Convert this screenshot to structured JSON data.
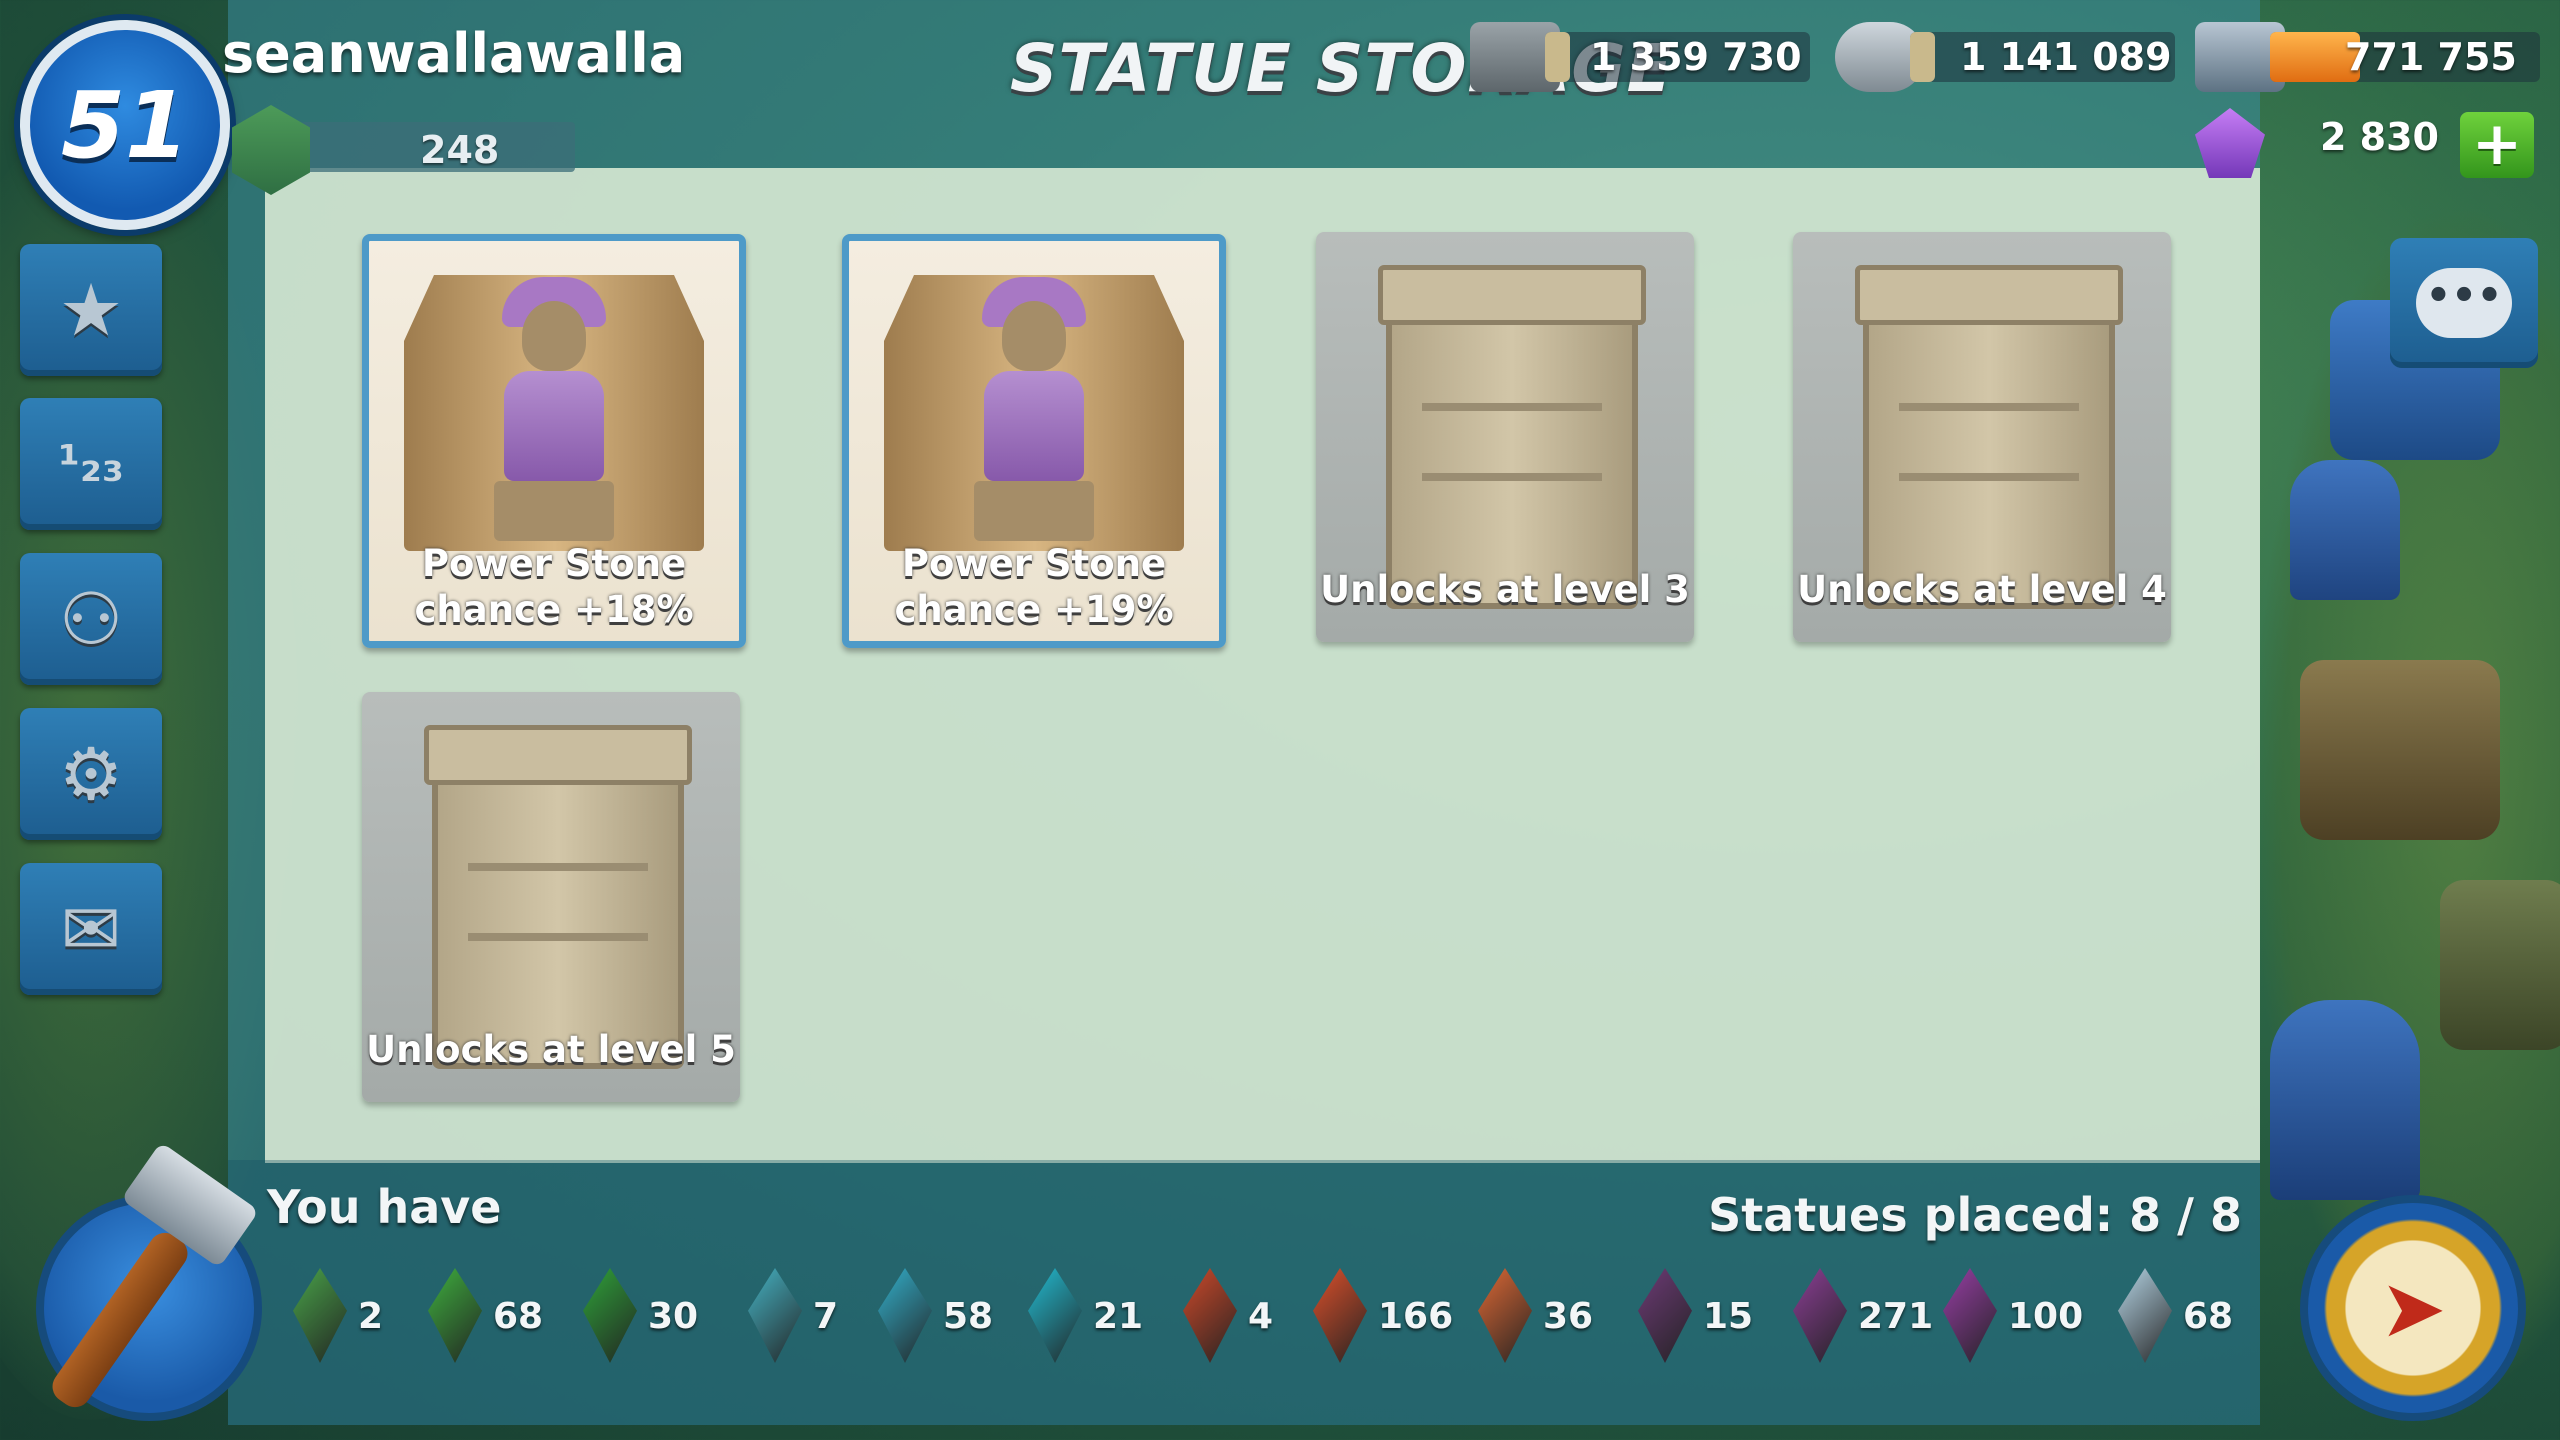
{
  "player": {
    "level": "51",
    "name": "seanwallawalla",
    "xp": "248"
  },
  "title": "STATUE STORAGE",
  "resources": {
    "wood": "1 359 730",
    "stone": "1 141 089",
    "iron": "771 755",
    "diamonds": "2 830",
    "add_diamonds": "+"
  },
  "side_menu": [
    {
      "name": "leaderboard-button",
      "icon": "stars-icon",
      "glyph": "★"
    },
    {
      "name": "rankings-button",
      "icon": "podium-icon",
      "glyph": "1 2 3"
    },
    {
      "name": "task-force-button",
      "icon": "group-icon",
      "glyph": "⚇"
    },
    {
      "name": "settings-button",
      "icon": "gears-icon",
      "glyph": "⚙"
    },
    {
      "name": "mail-button",
      "icon": "envelope-icon",
      "glyph": "✉"
    }
  ],
  "slots": [
    {
      "state": "filled",
      "caption_line1": "Power Stone",
      "caption_line2": "chance +18%"
    },
    {
      "state": "filled",
      "caption_line1": "Power Stone",
      "caption_line2": "chance +19%"
    },
    {
      "state": "locked",
      "caption": "Unlocks at level 3"
    },
    {
      "state": "locked",
      "caption": "Unlocks at level 4"
    },
    {
      "state": "locked",
      "caption": "Unlocks at level 5"
    }
  ],
  "inventory": {
    "label": "You have",
    "statues_placed": "Statues placed: 8 / 8",
    "items": [
      {
        "name": "life-fragment",
        "count": "2",
        "color": "#4aa64a"
      },
      {
        "name": "life-shard",
        "count": "68",
        "color": "#3fb33f"
      },
      {
        "name": "life-crystal",
        "count": "30",
        "color": "#2fa53a"
      },
      {
        "name": "ice-fragment",
        "count": "7",
        "color": "#46b6c7"
      },
      {
        "name": "ice-shard",
        "count": "58",
        "color": "#33b3cf"
      },
      {
        "name": "ice-crystal",
        "count": "21",
        "color": "#22c0d6"
      },
      {
        "name": "magma-fragment",
        "count": "4",
        "color": "#d14a2a"
      },
      {
        "name": "magma-shard",
        "count": "166",
        "color": "#e0512b"
      },
      {
        "name": "magma-crystal",
        "count": "36",
        "color": "#e26a35"
      },
      {
        "name": "dark-fragment",
        "count": "15",
        "color": "#6f3b78"
      },
      {
        "name": "dark-shard",
        "count": "271",
        "color": "#8e3f98"
      },
      {
        "name": "dark-crystal",
        "count": "100",
        "color": "#9a3fa8"
      },
      {
        "name": "idol-potion",
        "count": "68",
        "color": "#b9d9ea"
      }
    ]
  }
}
